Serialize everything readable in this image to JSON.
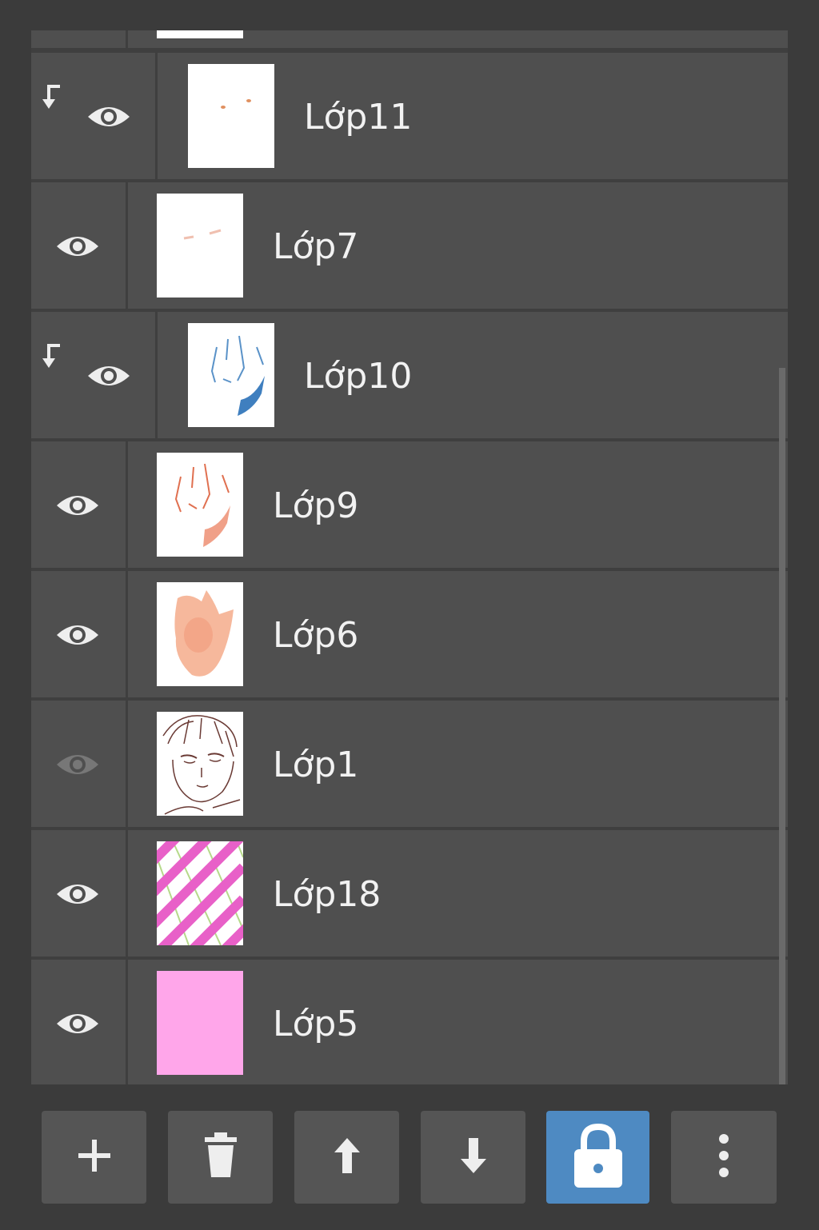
{
  "layers": [
    {
      "name": "Lớp11",
      "visible": true,
      "clipped": true
    },
    {
      "name": "Lớp7",
      "visible": true,
      "clipped": false
    },
    {
      "name": "Lớp10",
      "visible": true,
      "clipped": true
    },
    {
      "name": "Lớp9",
      "visible": true,
      "clipped": false
    },
    {
      "name": "Lớp6",
      "visible": true,
      "clipped": false
    },
    {
      "name": "Lớp1",
      "visible": false,
      "clipped": false
    },
    {
      "name": "Lớp18",
      "visible": true,
      "clipped": false
    },
    {
      "name": "Lớp5",
      "visible": true,
      "clipped": false
    }
  ],
  "toolbar": {
    "buttons": [
      {
        "icon": "plus-icon",
        "action": "add-layer"
      },
      {
        "icon": "trash-icon",
        "action": "delete-layer"
      },
      {
        "icon": "arrow-up-icon",
        "action": "move-layer-up"
      },
      {
        "icon": "arrow-down-icon",
        "action": "move-layer-down"
      },
      {
        "icon": "lock-icon",
        "action": "lock-layer",
        "active": true
      },
      {
        "icon": "more-vertical-icon",
        "action": "more-options"
      }
    ]
  },
  "colors": {
    "background": "#3b3b3b",
    "row": "#4f4f4f",
    "divider": "#3f3f3f",
    "toolbar_button": "#555555",
    "active_button": "#4e8ac2",
    "text": "#f2f2f2",
    "eye_visible": "#eeeeee",
    "eye_hidden": "#777777"
  }
}
